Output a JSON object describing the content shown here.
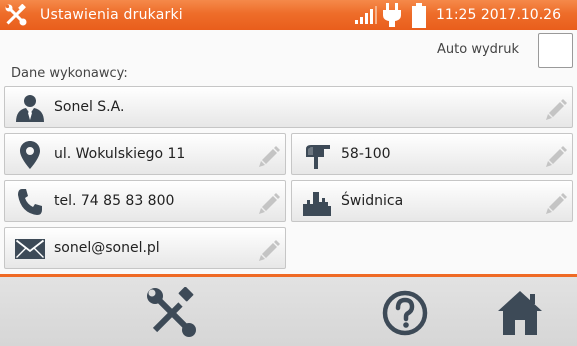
{
  "header": {
    "title": "Ustawienia drukarki",
    "time": "11:25",
    "date": "2017.10.26",
    "icons": [
      "tools-icon",
      "signal-icon",
      "plug-icon",
      "battery-icon"
    ]
  },
  "auto_print": {
    "label": "Auto wydruk",
    "checked": false
  },
  "contractor": {
    "label": "Dane wykonawcy:",
    "name": "Sonel S.A.",
    "street": "ul. Wokulskiego 11",
    "postal_code": "58-100",
    "phone": "tel. 74 85 83 800",
    "city": "Świdnica",
    "email": "sonel@sonel.pl"
  },
  "footer": {
    "buttons": [
      "tools-button",
      "help-button",
      "home-button"
    ]
  },
  "colors": {
    "accent": "#ee6d2a",
    "icon_dark": "#3d4a57",
    "pencil": "#c4c4c4"
  }
}
